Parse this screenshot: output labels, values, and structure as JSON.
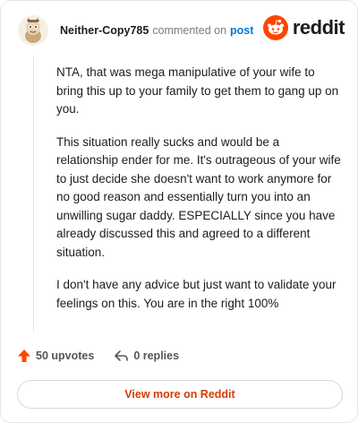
{
  "comment": {
    "username": "Neither-Copy785",
    "action_text": "commented on",
    "post_link": "post",
    "body": [
      "NTA, that was mega manipulative of your wife to bring this up to your family to get them to gang up on you.",
      "This situation really sucks and would be a relationship ender for me. It's outrageous of your wife to just decide she doesn't want to work anymore for no good reason and essentially turn you into an unwilling sugar daddy. ESPECIALLY since you have already discussed this and agreed to a different situation.",
      "I don't have any advice but just want to validate your feelings on this. You are in the right 100%"
    ],
    "upvotes": "50 upvotes",
    "replies": "0 replies"
  },
  "brand": {
    "wordmark": "reddit",
    "icon": "reddit-snoo-icon",
    "color": "#ff4500"
  },
  "view_more_label": "View more on Reddit",
  "colors": {
    "upvote": "#ff4500",
    "link": "#0079d3",
    "view_more": "#d93a00"
  }
}
